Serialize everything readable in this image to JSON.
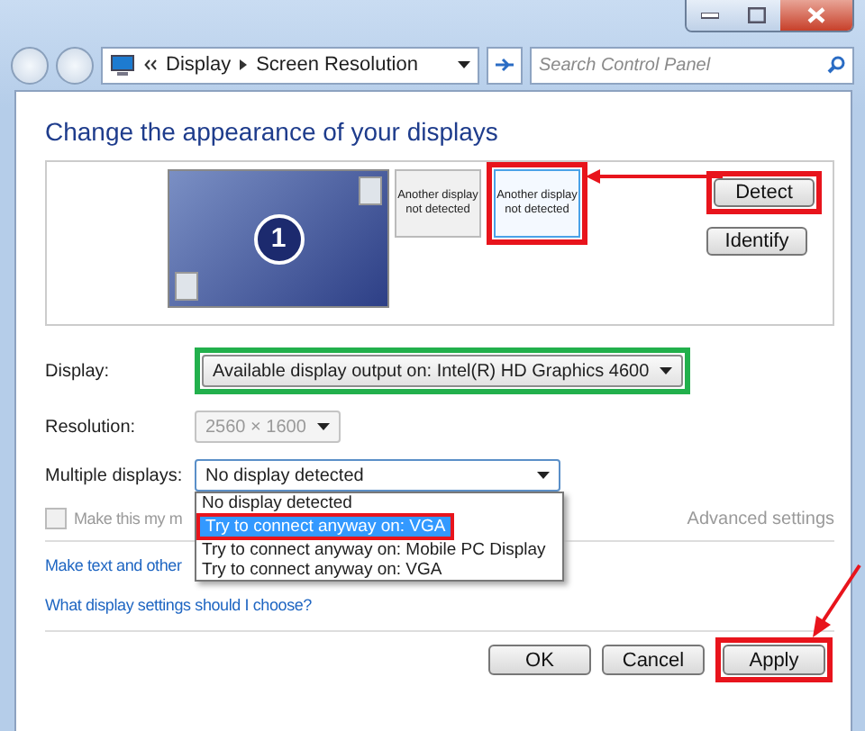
{
  "address": {
    "crumbs": [
      "Display",
      "Screen Resolution"
    ],
    "search_placeholder": "Search Control Panel"
  },
  "heading": "Change the appearance of your displays",
  "preview": {
    "monitor_label": "1",
    "tiles": [
      {
        "label": "Another display not detected",
        "selected": false
      },
      {
        "label": "Another display not detected",
        "selected": true,
        "color": "#e8141c"
      }
    ],
    "buttons": [
      {
        "label": "Detect",
        "color": "#e8141c"
      },
      {
        "label": "Identify"
      }
    ]
  },
  "fields": [
    {
      "label": "Display:",
      "value": "Available display output on: Intel(R) HD Graphics 4600",
      "disabled": false,
      "color": "#22b04c"
    },
    {
      "label": "Resolution:",
      "value": "2560 × 1600",
      "disabled": true
    },
    {
      "label": "Multiple displays:",
      "value": "No display detected",
      "disabled": false
    }
  ],
  "dropdown": [
    {
      "label": "No display detected",
      "selected": false
    },
    {
      "label": "Try to connect anyway on: VGA",
      "selected": true,
      "color": "#e8141c"
    },
    {
      "label": "Try to connect anyway on: Mobile PC Display",
      "selected": false
    },
    {
      "label": "Try to connect anyway on: VGA",
      "selected": false
    }
  ],
  "checkbox": {
    "label": "Make this my m",
    "checked": false,
    "disabled": true
  },
  "advanced": {
    "label": "Advanced settings",
    "disabled": true
  },
  "links": [
    "Make text and other",
    "What display settings should I choose?"
  ],
  "buttons": [
    {
      "label": "OK"
    },
    {
      "label": "Cancel"
    },
    {
      "label": "Apply",
      "color": "#e8141c"
    }
  ]
}
